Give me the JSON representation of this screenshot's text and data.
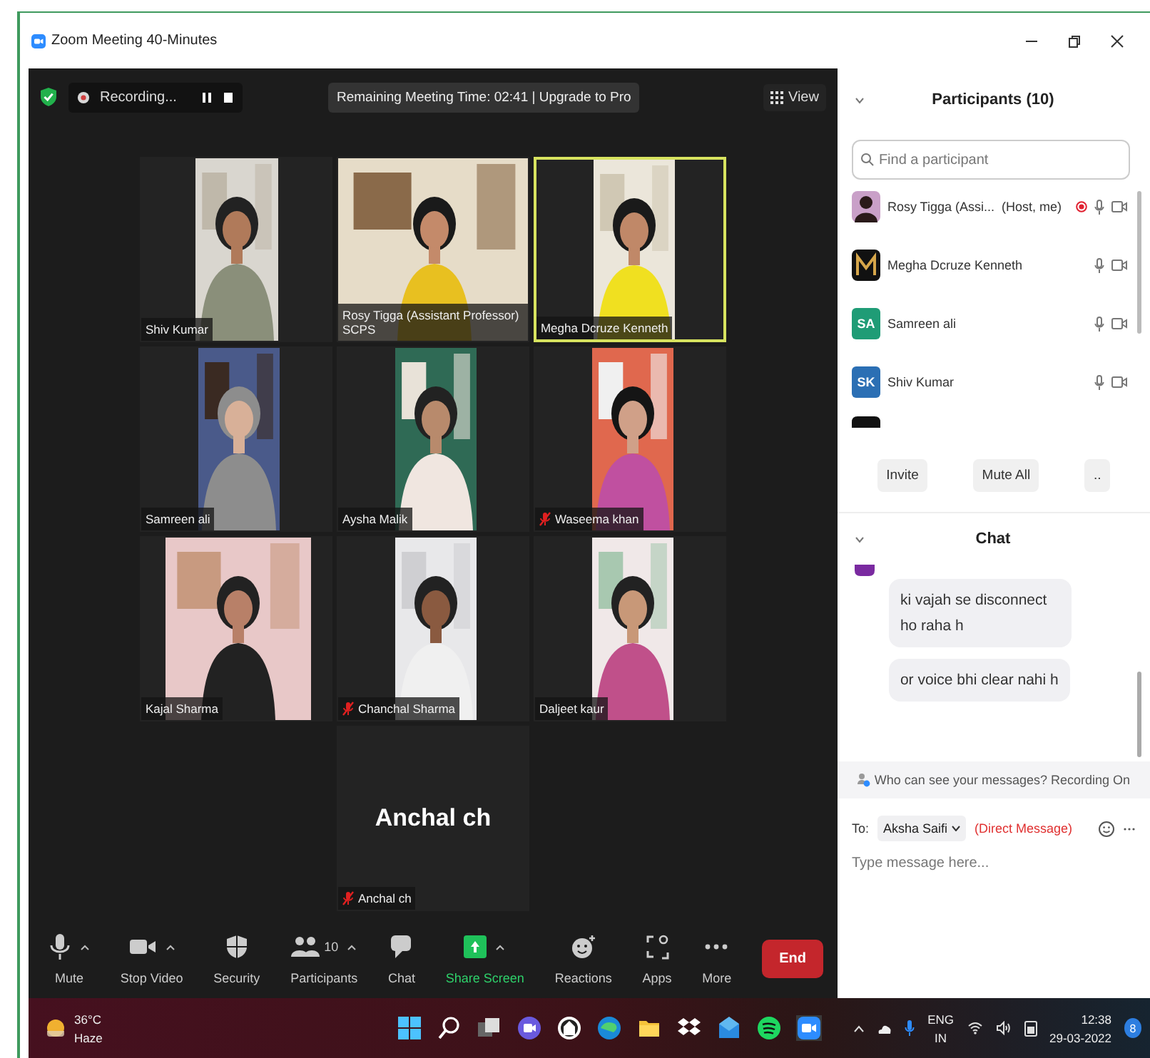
{
  "window": {
    "title": "Zoom Meeting 40-Minutes"
  },
  "top_bar": {
    "recording": "Recording...",
    "remaining": "Remaining Meeting Time: 02:41 | Upgrade to Pro",
    "view": "View"
  },
  "tiles": [
    {
      "kind": "video",
      "label": "Shiv Kumar",
      "muted": false,
      "speaking": false
    },
    {
      "kind": "video",
      "label": "Rosy Tigga (Assistant Professor) SCPS",
      "muted": false,
      "speaking": false
    },
    {
      "kind": "video",
      "label": "Megha Dcruze Kenneth",
      "muted": false,
      "speaking": true
    },
    {
      "kind": "video",
      "label": "Samreen ali",
      "muted": false,
      "speaking": false
    },
    {
      "kind": "video",
      "label": "Aysha Malik",
      "muted": false,
      "speaking": false
    },
    {
      "kind": "video",
      "label": "Waseema khan",
      "muted": true,
      "speaking": false
    },
    {
      "kind": "video",
      "label": "Kajal Sharma",
      "muted": false,
      "speaking": false
    },
    {
      "kind": "video",
      "label": "Chanchal Sharma",
      "muted": true,
      "speaking": false
    },
    {
      "kind": "video",
      "label": "Daljeet kaur",
      "muted": false,
      "speaking": false
    },
    {
      "kind": "avatar",
      "display_name": "Anchal ch",
      "label": "Anchal ch",
      "muted": true,
      "speaking": false
    }
  ],
  "toolbar": {
    "items": [
      {
        "kind": "mute",
        "label": "Mute",
        "menu": true
      },
      {
        "kind": "video",
        "label": "Stop Video",
        "menu": true
      },
      {
        "kind": "security",
        "label": "Security",
        "menu": false
      },
      {
        "kind": "participants",
        "label": "Participants",
        "count": "10",
        "menu": true
      },
      {
        "kind": "chat",
        "label": "Chat",
        "menu": false
      },
      {
        "kind": "share",
        "label": "Share Screen",
        "menu": true
      },
      {
        "kind": "reactions",
        "label": "Reactions",
        "menu": false
      },
      {
        "kind": "apps",
        "label": "Apps",
        "menu": false
      },
      {
        "kind": "more",
        "label": "More",
        "menu": false
      }
    ],
    "end": "End"
  },
  "participants": {
    "title": "Participants (10)",
    "search_placeholder": "Find a participant",
    "list": [
      {
        "name": "Rosy Tigga (Assi...",
        "role": "(Host, me)",
        "recording": true
      },
      {
        "name": "Megha Dcruze Kenneth",
        "kind": "logo",
        "recording": false
      },
      {
        "name": "Samreen ali",
        "kind": "initials",
        "initials": "SA",
        "color": "#1f9c76",
        "recording": false
      },
      {
        "name": "Shiv Kumar",
        "kind": "initials",
        "initials": "SK",
        "color": "#2b6fb4",
        "recording": false
      }
    ],
    "buttons": [
      "Invite",
      "Mute All",
      ".."
    ]
  },
  "chat": {
    "title": "Chat",
    "messages": [
      "ki vajah se disconnect ho raha h",
      "or voice bhi clear nahi h"
    ],
    "notice": "Who can see your messages? Recording On",
    "to_label": "To:",
    "recipient": "Aksha Saifi",
    "direct": "(Direct Message)",
    "placeholder": "Type message here..."
  },
  "taskbar": {
    "temp": "36°C",
    "condition": "Haze",
    "language": [
      "ENG",
      "IN"
    ],
    "time": "12:38",
    "date": "29-03-2022",
    "notifications": "8"
  }
}
